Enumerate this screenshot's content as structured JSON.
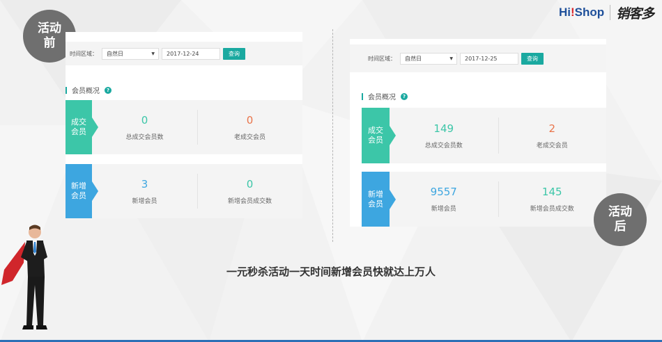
{
  "badges": {
    "before": "活动\n前",
    "after": "活动\n后"
  },
  "logo": {
    "hi_prefix": "Hi",
    "hi_dot": "!",
    "hi_suffix": "Shop",
    "xkd": "销客多"
  },
  "before": {
    "filter": {
      "label": "时间区域：",
      "select": "自然日",
      "date": "2017-12-24",
      "button": "查询"
    },
    "section_title": "会员概况",
    "rows": [
      {
        "label": "成交\n会员",
        "cells": [
          {
            "value": "0",
            "caption": "总成交会员数"
          },
          {
            "value": "0",
            "caption": "老成交会员"
          }
        ]
      },
      {
        "label": "新增\n会员",
        "cells": [
          {
            "value": "3",
            "caption": "新增会员"
          },
          {
            "value": "0",
            "caption": "新增会员成交数"
          }
        ]
      }
    ]
  },
  "after": {
    "filter": {
      "label": "时间区域：",
      "select": "自然日",
      "date": "2017-12-25",
      "button": "查询"
    },
    "section_title": "会员概况",
    "rows": [
      {
        "label": "成交\n会员",
        "cells": [
          {
            "value": "149",
            "caption": "总成交会员数"
          },
          {
            "value": "2",
            "caption": "老成交会员"
          }
        ]
      },
      {
        "label": "新增\n会员",
        "cells": [
          {
            "value": "9557",
            "caption": "新增会员"
          },
          {
            "value": "145",
            "caption": "新增会员成交数"
          }
        ]
      }
    ]
  },
  "caption": "一元秒杀活动一天时间新增会员快就达上万人",
  "colors": {
    "teal": "#1aa9a0",
    "green": "#3cc6a8",
    "blue": "#3da6e0",
    "orange": "#e9744a",
    "badge": "#6f6f6f"
  },
  "icons": [
    "help-icon",
    "dropdown-arrow-icon",
    "superhero-figure"
  ]
}
